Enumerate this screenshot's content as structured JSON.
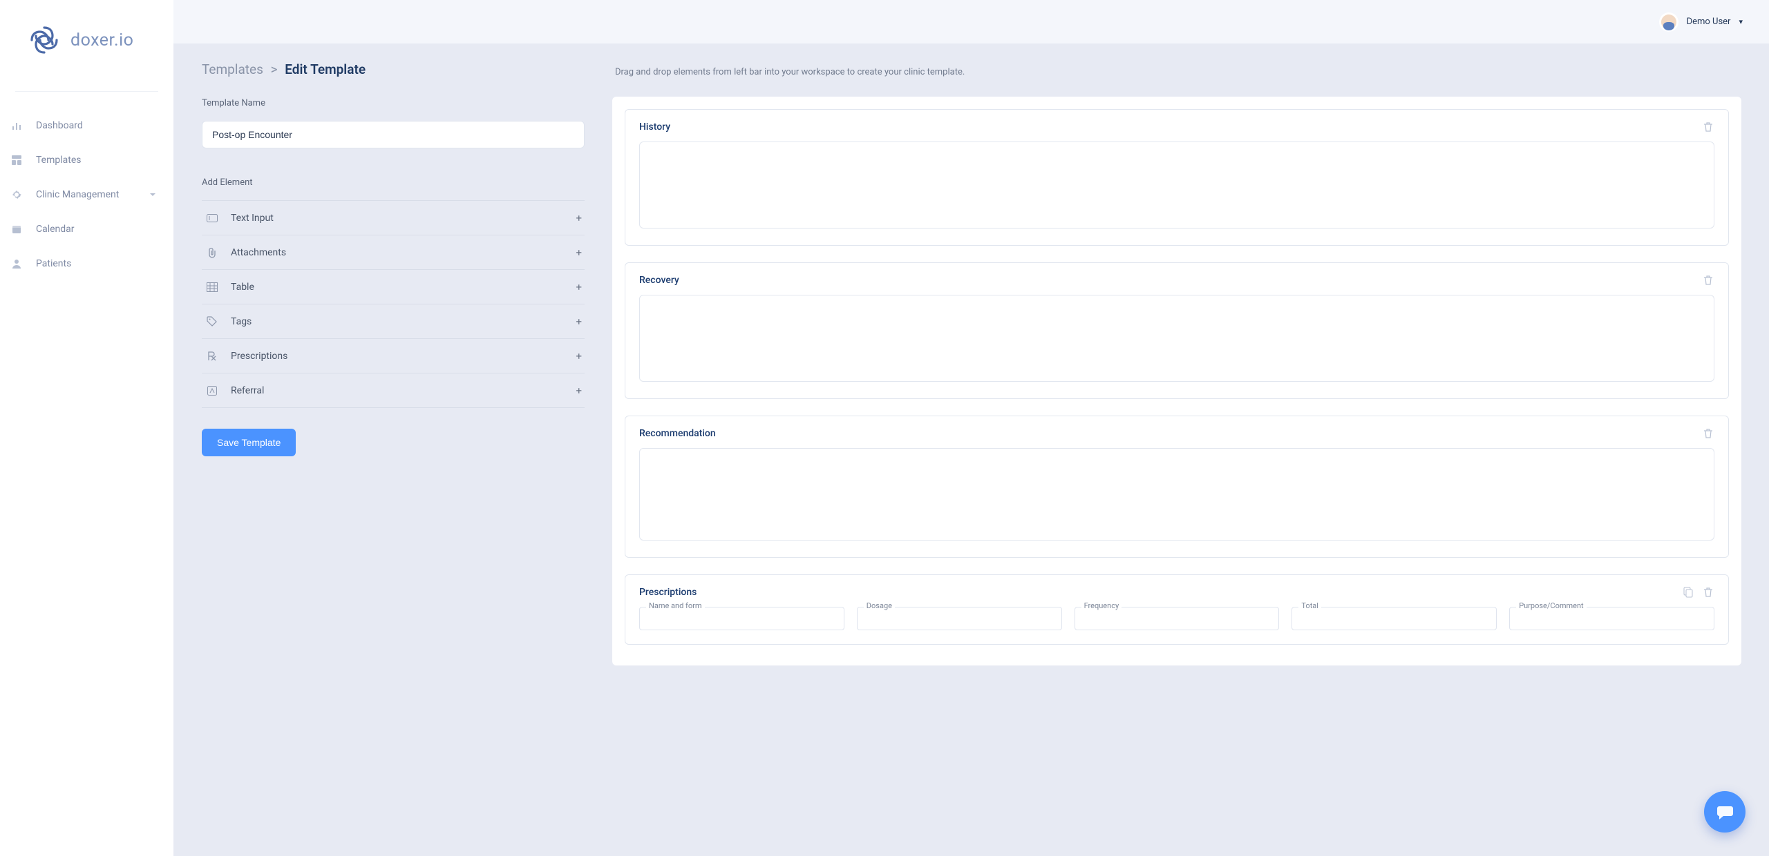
{
  "brand": {
    "name": "doxer.io"
  },
  "user": {
    "name": "Demo User"
  },
  "nav": {
    "items": [
      {
        "label": "Dashboard"
      },
      {
        "label": "Templates"
      },
      {
        "label": "Clinic Management",
        "expandable": true
      },
      {
        "label": "Calendar"
      },
      {
        "label": "Patients"
      }
    ]
  },
  "breadcrumb": {
    "parent": "Templates",
    "sep": ">",
    "current": "Edit Template"
  },
  "labels": {
    "template_name": "Template Name",
    "add_element": "Add Element",
    "save": "Save Template"
  },
  "template": {
    "name": "Post-op Encounter"
  },
  "elements": [
    {
      "key": "text-input",
      "label": "Text Input"
    },
    {
      "key": "attachments",
      "label": "Attachments"
    },
    {
      "key": "table",
      "label": "Table"
    },
    {
      "key": "tags",
      "label": "Tags"
    },
    {
      "key": "prescriptions",
      "label": "Prescriptions"
    },
    {
      "key": "referral",
      "label": "Referral"
    }
  ],
  "workspace": {
    "hint": "Drag and drop elements from left bar into your workspace to create your clinic template.",
    "cards": {
      "history": {
        "title": "History"
      },
      "recovery": {
        "title": "Recovery"
      },
      "recommendation": {
        "title": "Recommendation"
      },
      "prescriptions": {
        "title": "Prescriptions",
        "fields": {
          "name": "Name and form",
          "dosage": "Dosage",
          "frequency": "Frequency",
          "total": "Total",
          "purpose": "Purpose/Comment"
        }
      }
    }
  }
}
